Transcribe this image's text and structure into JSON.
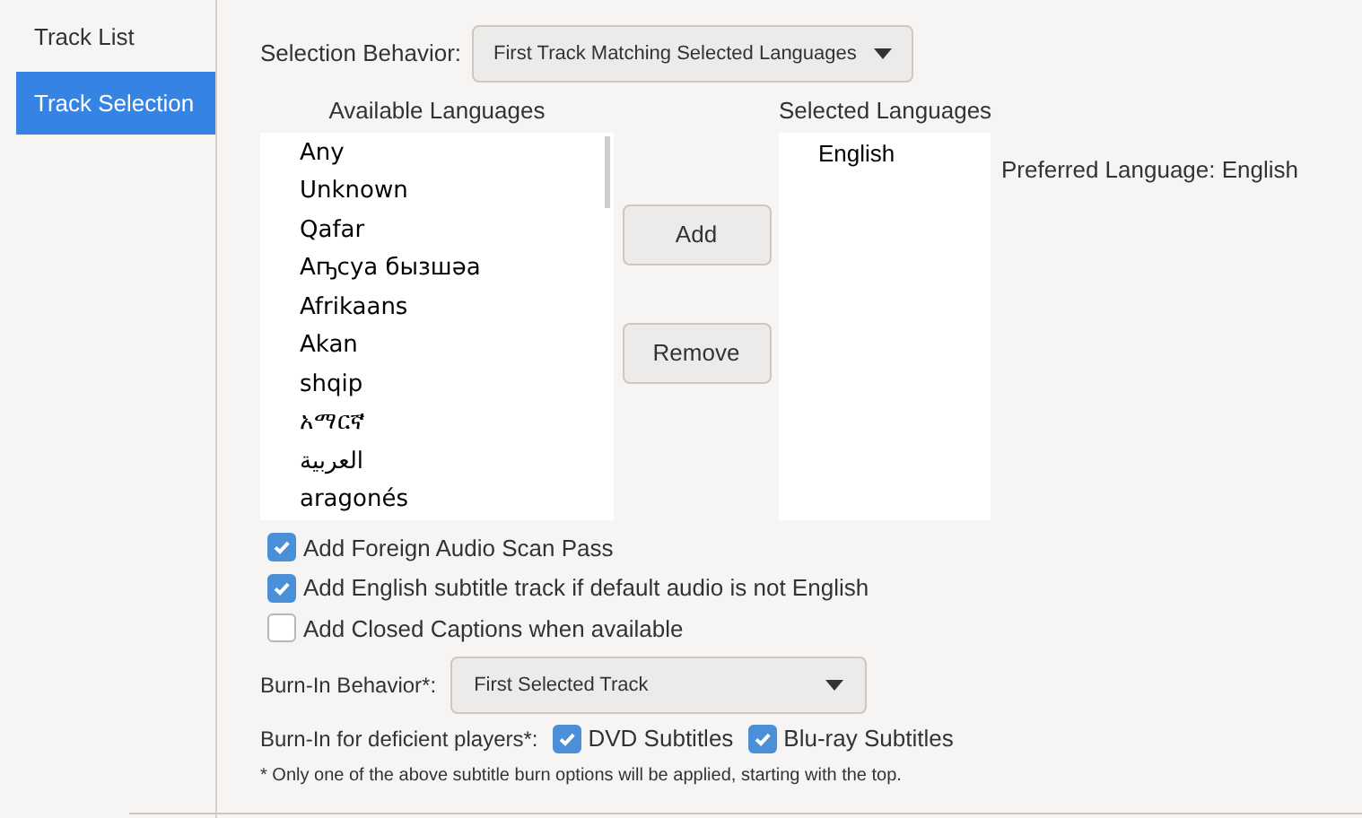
{
  "sidebar": {
    "items": [
      {
        "label": "Track List",
        "selected": false
      },
      {
        "label": "Track Selection",
        "selected": true
      }
    ]
  },
  "selection_behavior": {
    "label": "Selection Behavior:",
    "value": "First Track Matching Selected Languages"
  },
  "available_languages": {
    "title": "Available Languages",
    "items": [
      "Any",
      "Unknown",
      "Qafar",
      "Аҧсуа бызшәа",
      "Afrikaans",
      "Akan",
      "shqip",
      "አማርኛ",
      "العربية",
      "aragonés"
    ]
  },
  "buttons": [
    "Add",
    "Remove"
  ],
  "selected_languages": {
    "title": "Selected Languages",
    "items": [
      "English"
    ]
  },
  "preferred_language": "Preferred Language: English",
  "options": [
    {
      "label": "Add Foreign Audio Scan Pass",
      "checked": true
    },
    {
      "label": "Add English subtitle track if default audio is not English",
      "checked": true
    },
    {
      "label": "Add Closed Captions when available",
      "checked": false
    }
  ],
  "burn_in_behavior": {
    "label": "Burn-In Behavior*:",
    "value": "First Selected Track"
  },
  "burn_in_deficient": {
    "label": "Burn-In for deficient players*:",
    "options": [
      {
        "label": "DVD Subtitles",
        "checked": true
      },
      {
        "label": "Blu-ray Subtitles",
        "checked": true
      }
    ]
  },
  "footnote": "* Only one of the above subtitle burn options will be applied, starting with the top."
}
